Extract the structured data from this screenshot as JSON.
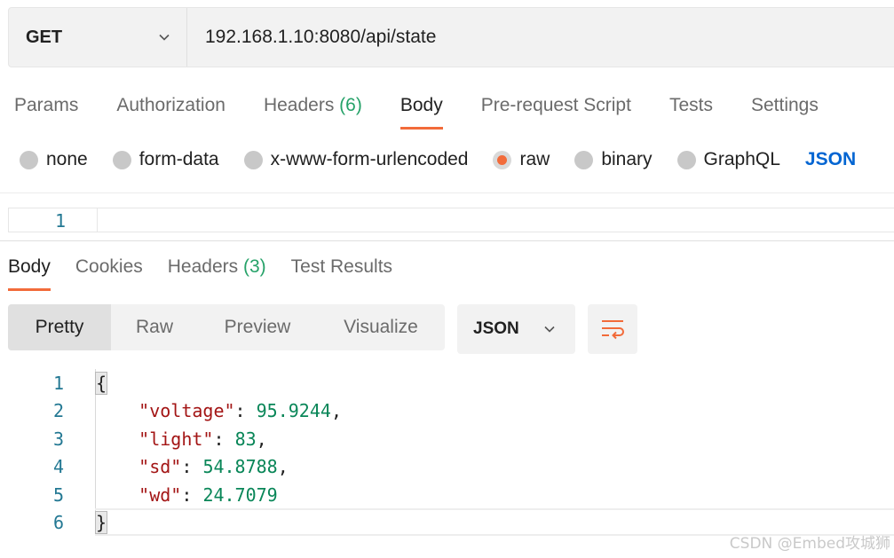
{
  "request": {
    "method": "GET",
    "url": "192.168.1.10:8080/api/state"
  },
  "request_tabs": [
    {
      "label": "Params"
    },
    {
      "label": "Authorization"
    },
    {
      "label": "Headers",
      "count": "(6)"
    },
    {
      "label": "Body",
      "active": true
    },
    {
      "label": "Pre-request Script"
    },
    {
      "label": "Tests"
    },
    {
      "label": "Settings"
    }
  ],
  "body_types": {
    "options": [
      "none",
      "form-data",
      "x-www-form-urlencoded",
      "raw",
      "binary",
      "GraphQL"
    ],
    "selected": "raw",
    "format_link": "JSON"
  },
  "request_editor": {
    "line_numbers": [
      "1"
    ]
  },
  "response_tabs": [
    {
      "label": "Body",
      "active": true
    },
    {
      "label": "Cookies"
    },
    {
      "label": "Headers",
      "count": "(3)"
    },
    {
      "label": "Test Results"
    }
  ],
  "view_modes": [
    "Pretty",
    "Raw",
    "Preview",
    "Visualize"
  ],
  "active_view": "Pretty",
  "format_select": "JSON",
  "response_body": {
    "line_numbers": [
      "1",
      "2",
      "3",
      "4",
      "5",
      "6"
    ],
    "open_brace": "{",
    "close_brace": "}",
    "fields": [
      {
        "key": "\"voltage\"",
        "value": "95.9244",
        "comma": ","
      },
      {
        "key": "\"light\"",
        "value": "83",
        "comma": ","
      },
      {
        "key": "\"sd\"",
        "value": "54.8788",
        "comma": ","
      },
      {
        "key": "\"wd\"",
        "value": "24.7079",
        "comma": ""
      }
    ]
  },
  "watermark": "CSDN @Embed攻城狮",
  "colors": {
    "accent": "#f26b3a",
    "link": "#0265d2",
    "count": "#26a269",
    "json_key": "#a31515",
    "json_number": "#098658",
    "line_number": "#237893"
  },
  "icons": [
    "chevron-down-icon",
    "radio-icon",
    "wrap-lines-icon"
  ]
}
